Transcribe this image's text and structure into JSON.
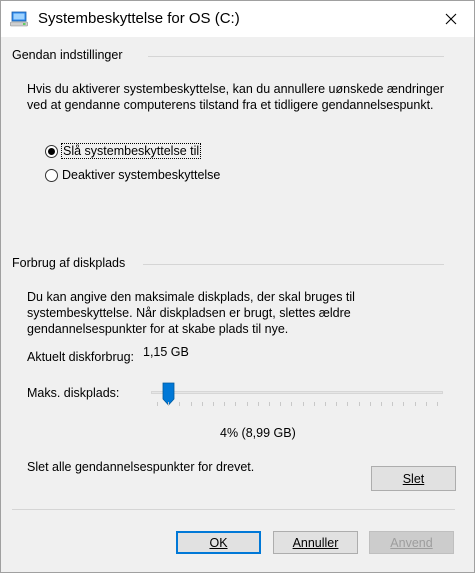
{
  "window": {
    "title": "Systembeskyttelse for OS (C:)",
    "icon": "system-protection-icon",
    "close": "close-icon"
  },
  "settings": {
    "group_label": "Gendan indstillinger",
    "description_line1": "Hvis du aktiverer systembeskyttelse, kan du annullere uønskede ændringer",
    "description_line2": "ved at gendanne computerens tilstand fra et tidligere gendannelsespunkt.",
    "options": [
      {
        "label": "Slå systembeskyttelse til",
        "checked": true
      },
      {
        "label": "Deaktiver systembeskyttelse",
        "checked": false
      }
    ]
  },
  "diskusage": {
    "group_label": "Forbrug af diskplads",
    "description_line1": "Du kan angive den maksimale diskplads, der skal bruges til",
    "description_line2": "systembeskyttelse. Når diskpladsen er brugt, slettes ældre",
    "description_line3": "gendannelsespunkter for at skabe plads til nye.",
    "current_label": "Aktuelt diskforbrug:",
    "current_value": "1,15 GB",
    "max_label": "Maks. diskplads:",
    "max_fraction": 0.04,
    "max_value_text": "4% (8,99 GB)",
    "delete_text": "Slet alle gendannelsespunkter for drevet.",
    "delete_button": "Slet"
  },
  "footer": {
    "ok": "OK",
    "cancel": "Annuller",
    "apply": "Anvend"
  },
  "colors": {
    "accent": "#0078d7"
  }
}
